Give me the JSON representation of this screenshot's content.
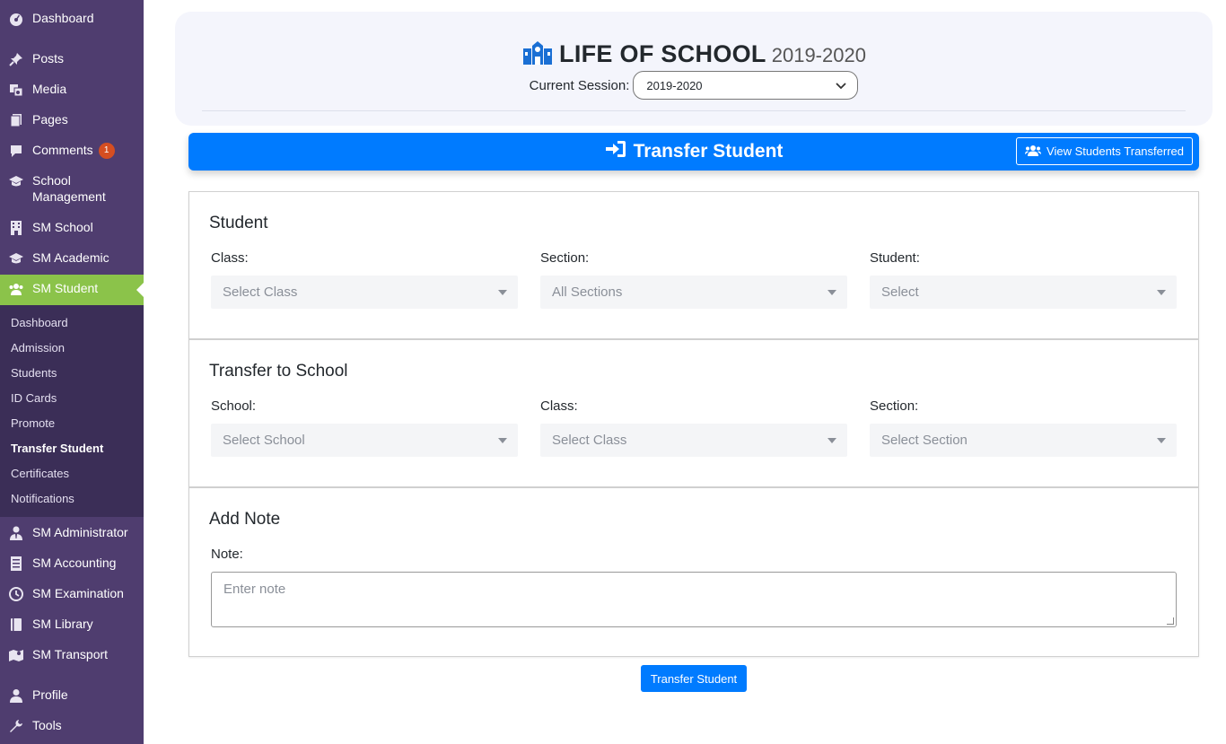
{
  "sidebar": {
    "items_top": [
      {
        "label": "Dashboard",
        "icon": "dashboard-icon"
      },
      {
        "label": "Posts",
        "icon": "pin-icon"
      },
      {
        "label": "Media",
        "icon": "media-icon"
      },
      {
        "label": "Pages",
        "icon": "pages-icon"
      },
      {
        "label": "Comments",
        "icon": "comment-icon",
        "badge": "1"
      },
      {
        "label": "School Management",
        "icon": "graduation-cap-icon"
      },
      {
        "label": "SM School",
        "icon": "building-icon"
      },
      {
        "label": "SM Academic",
        "icon": "graduation-cap-icon"
      },
      {
        "label": "SM Student",
        "icon": "users-icon"
      }
    ],
    "submenu": [
      "Dashboard",
      "Admission",
      "Students",
      "ID Cards",
      "Promote",
      "Transfer Student",
      "Certificates",
      "Notifications"
    ],
    "submenu_current": "Transfer Student",
    "items_bottom": [
      {
        "label": "SM Administrator",
        "icon": "user-tie-icon"
      },
      {
        "label": "SM Accounting",
        "icon": "ledger-icon"
      },
      {
        "label": "SM Examination",
        "icon": "clock-icon"
      },
      {
        "label": "SM Library",
        "icon": "book-icon"
      },
      {
        "label": "SM Transport",
        "icon": "map-icon"
      },
      {
        "label": "Profile",
        "icon": "user-icon"
      },
      {
        "label": "Tools",
        "icon": "wrench-icon"
      }
    ]
  },
  "header": {
    "school_name": "LIFE OF SCHOOL",
    "session_year": "2019-2020",
    "current_session_label": "Current Session:",
    "current_session_value": "2019-2020"
  },
  "transfer_bar": {
    "title": "Transfer Student",
    "view_button": "View Students Transferred"
  },
  "student_panel": {
    "heading": "Student",
    "class_label": "Class:",
    "class_placeholder": "Select Class",
    "section_label": "Section:",
    "section_placeholder": "All Sections",
    "student_label": "Student:",
    "student_placeholder": "Select"
  },
  "school_panel": {
    "heading": "Transfer to School",
    "school_label": "School:",
    "school_placeholder": "Select School",
    "class_label": "Class:",
    "class_placeholder": "Select Class",
    "section_label": "Section:",
    "section_placeholder": "Select Section"
  },
  "note_panel": {
    "heading": "Add Note",
    "note_label": "Note:",
    "note_placeholder": "Enter note"
  },
  "submit_label": "Transfer Student",
  "colors": {
    "sidebar_bg": "#4f3d6f",
    "submenu_bg": "#3b2e57",
    "active_item": "#8bc34a",
    "primary": "#007bff",
    "badge": "#d54e21"
  }
}
